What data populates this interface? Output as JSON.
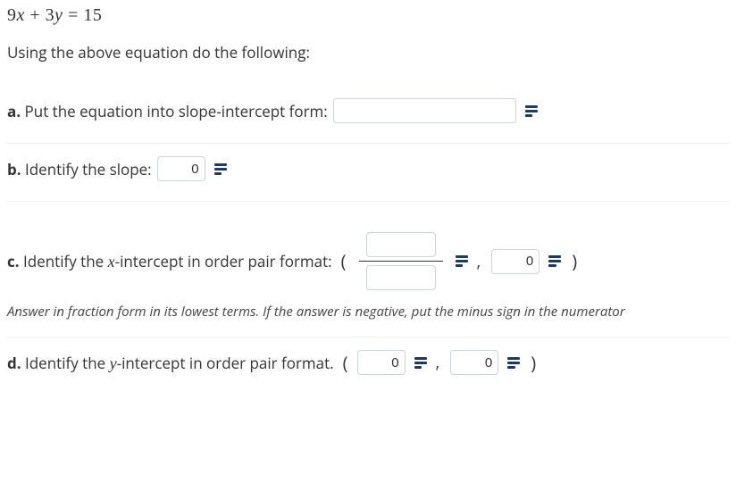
{
  "equation": "9x + 3y = 15",
  "intro": "Using the above equation do the following:",
  "parts": {
    "a": {
      "prefix": "a.",
      "text": " Put the equation into slope-intercept form:"
    },
    "b": {
      "prefix": "b.",
      "text": " Identify the slope:",
      "value": "0"
    },
    "c": {
      "prefix": "c.",
      "text_before": " Identify the ",
      "var": "x",
      "text_after": "-intercept in order pair format:",
      "y_value": "0",
      "hint": "Answer in fraction form in its lowest terms. If the answer is negative, put the minus sign in the numerator"
    },
    "d": {
      "prefix": "d.",
      "text_before": " Identify the ",
      "var": "y",
      "text_after": "-intercept in order pair format.",
      "x_value": "0",
      "y_value": "0"
    }
  },
  "equation_parts": {
    "t1": "9",
    "v1": "x",
    "t2": " + 3",
    "v2": "y",
    "t3": " = 15"
  }
}
